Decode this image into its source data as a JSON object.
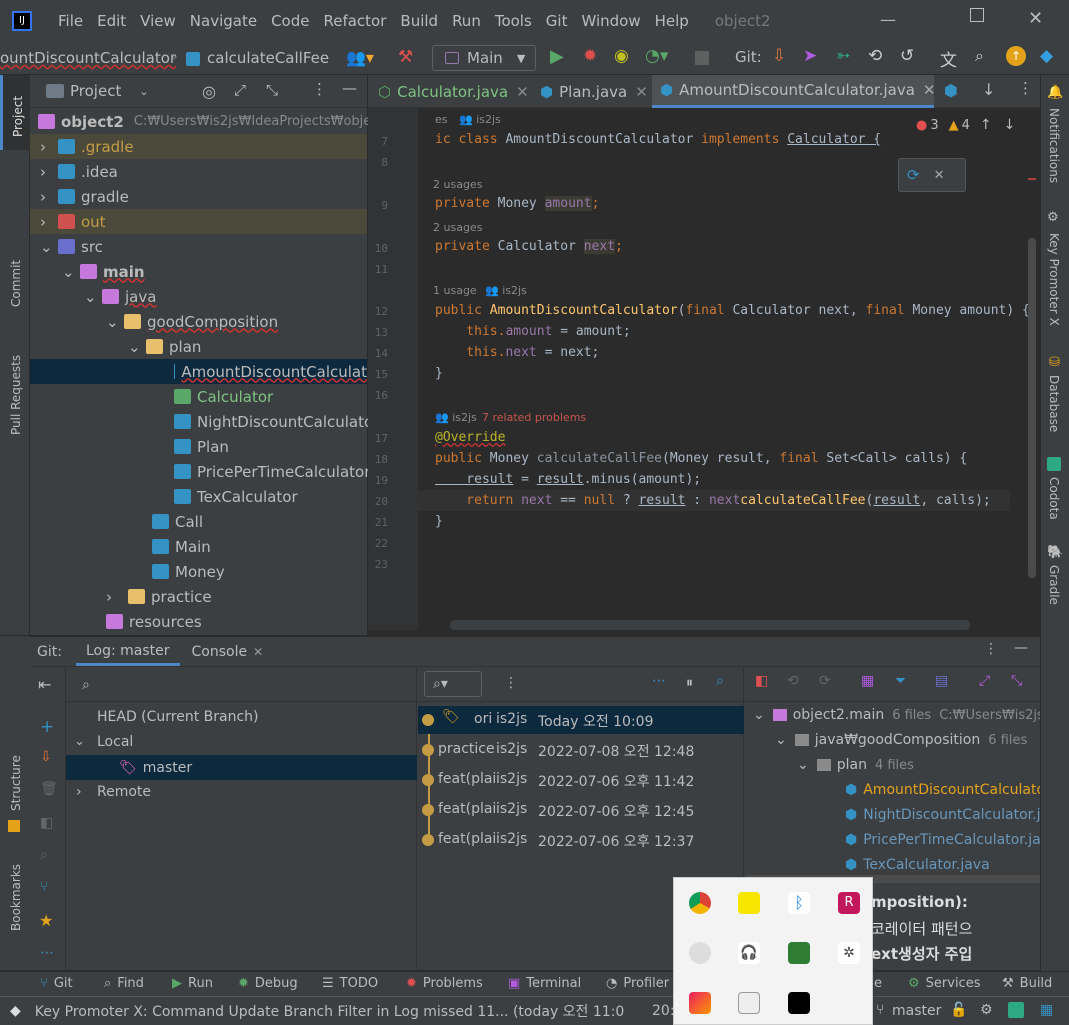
{
  "menu": {
    "items": [
      "File",
      "Edit",
      "View",
      "Navigate",
      "Code",
      "Refactor",
      "Build",
      "Run",
      "Tools",
      "Git",
      "Window",
      "Help"
    ],
    "project": "object2"
  },
  "toolbar": {
    "breadcrumb_class": "ountDiscountCalculator",
    "breadcrumb_method": "calculateCallFee",
    "run_config": "Main",
    "git_label": "Git:"
  },
  "left_stripe": {
    "project": "Project",
    "commit": "Commit",
    "pull_requests": "Pull Requests",
    "structure": "Structure",
    "bookmarks": "Bookmarks"
  },
  "right_stripe": {
    "notifications": "Notifications",
    "key_promoter": "Key Promoter X",
    "database": "Database",
    "codota": "Codota",
    "gradle": "Gradle"
  },
  "project": {
    "header": "Project",
    "root": "object2",
    "root_path": "C:₩Users₩is2js₩IdeaProjects₩object",
    "items": [
      ".gradle",
      ".idea",
      "gradle",
      "out",
      "src",
      "main",
      "java",
      "goodComposition",
      "plan",
      "AmountDiscountCalculat",
      "Calculator",
      "NightDiscountCalculator",
      "Plan",
      "PricePerTimeCalculator",
      "TexCalculator",
      "Call",
      "Main",
      "Money",
      "practice",
      "resources"
    ]
  },
  "tabs": [
    "Calculator.java",
    "Plan.java",
    "AmountDiscountCalculator.java"
  ],
  "editor": {
    "errors": "3",
    "warnings": "4",
    "lines": [
      "7",
      "8",
      "9",
      "10",
      "11",
      "12",
      "13",
      "14",
      "15",
      "16",
      "17",
      "18",
      "19",
      "20",
      "21",
      "22",
      "23"
    ],
    "hints": {
      "h1": "es",
      "h1_author": "is2js",
      "h2": "2 usages",
      "h3": "2 usages",
      "h4": "1 usage",
      "h4_author": "is2js",
      "h5_author": "is2js",
      "h5_problems": "7 related problems"
    },
    "code": {
      "l7a": "ic class ",
      "l7b": "AmountDiscountCalculator ",
      "l7c": "implements ",
      "l7d": "Calculator {",
      "l9a": "private ",
      "l9b": "Money ",
      "l9c": "amount",
      "l9d": ";",
      "l10a": "private ",
      "l10b": "Calculator ",
      "l10c": "next",
      "l10d": ";",
      "l12a": "public ",
      "l12b": "AmountDiscountCalculator",
      "l12c": "(",
      "l12d": "final ",
      "l12e": "Calculator next, ",
      "l12f": "final ",
      "l12g": "Money amount) {",
      "l13a": "    this.",
      "l13b": "amount",
      "l13c": " = amount;",
      "l14a": "    this.",
      "l14b": "next",
      "l14c": " = next;",
      "l15": "}",
      "l17": "@Override",
      "l18a": "public ",
      "l18b": "Money ",
      "l18c": "calculateCallFee",
      "l18d": "(Money result, ",
      "l18e": "final ",
      "l18f": "Set<Call> calls) {",
      "l19a": "    result",
      "l19b": " = ",
      "l19c": "result",
      "l19d": ".minus(amount);",
      "l20a": "    return ",
      "l20b": "next",
      "l20c": " == ",
      "l20d": "null",
      "l20e": " ? ",
      "l20f": "result",
      "l20g": " : ",
      "l20h": "next",
      ".": ".",
      "l20i": "calculateCallFee",
      "l20j": "(",
      "l20k": "result",
      "l20l": ", calls);",
      "l21": "}"
    }
  },
  "git": {
    "tabs": {
      "git": "Git:",
      "log": "Log: master",
      "console": "Console"
    },
    "branches": {
      "head": "HEAD (Current Branch)",
      "local": "Local",
      "master": "master",
      "remote": "Remote"
    },
    "commits": [
      {
        "msg": "ori",
        "author": "is2js",
        "date": "Today 오전 10:09"
      },
      {
        "msg": "practice",
        "author": "is2js",
        "date": "2022-07-08 오전 12:48"
      },
      {
        "msg": "feat(plai",
        "author": "is2js",
        "date": "2022-07-06 오후 11:42"
      },
      {
        "msg": "feat(plai",
        "author": "is2js",
        "date": "2022-07-06 오후 12:45"
      },
      {
        "msg": "feat(plai",
        "author": "is2js",
        "date": "2022-07-06 오후 12:37"
      }
    ],
    "details": {
      "root": "object2.main",
      "root_count": "6 files",
      "root_path": "C:₩Users₩is2js",
      "folder": "java₩goodComposition",
      "folder_count": "6 files",
      "plan": "plan",
      "plan_count": "4 files",
      "files": [
        "AmountDiscountCalculato",
        "NightDiscountCalculator.j",
        "PricePerTimeCalculator.jav",
        "TexCalculator.java"
      ],
      "msg_lines": [
        "mposition):",
        "코레이터 패턴으",
        "ext생성자 주입"
      ]
    }
  },
  "toolwindows": [
    "Git",
    "Find",
    "Run",
    "Debug",
    "TODO",
    "Problems",
    "Terminal",
    "Profiler",
    "Services",
    "Build"
  ],
  "toolwindow_partial": "e",
  "status": {
    "message": "Key Promoter X: Command Update Branch Filter in Log missed 11... (today 오전 11:0",
    "time": "20:",
    "branch": "master"
  }
}
